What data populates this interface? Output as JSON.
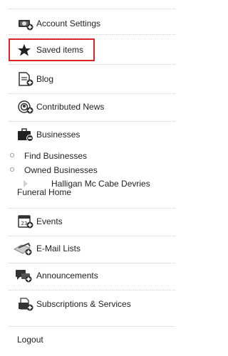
{
  "menu": {
    "items": [
      {
        "label": "Account Settings",
        "icon": "account-settings-icon"
      },
      {
        "label": "Saved items",
        "icon": "star-icon"
      },
      {
        "label": "Blog",
        "icon": "blog-icon"
      },
      {
        "label": "Contributed News",
        "icon": "contributed-news-icon"
      },
      {
        "label": "Businesses",
        "icon": "briefcase-icon"
      },
      {
        "label": "Events",
        "icon": "calendar-icon"
      },
      {
        "label": "E-Mail Lists",
        "icon": "email-lists-icon"
      },
      {
        "label": "Announcements",
        "icon": "announcements-icon"
      },
      {
        "label": "Subscriptions & Services",
        "icon": "subscriptions-icon"
      }
    ],
    "businesses_sub": {
      "find": "Find Businesses",
      "owned": "Owned Businesses",
      "owned_item": "Halligan Mc Cabe Devries Funeral Home",
      "owned_item_line1": "Halligan Mc Cabe Devries",
      "owned_item_line2": "Funeral Home"
    },
    "calendar_day": "23",
    "logout": "Logout"
  },
  "colors": {
    "selected_border": "#d9232d",
    "text": "#222222",
    "icon_dark": "#333333"
  }
}
